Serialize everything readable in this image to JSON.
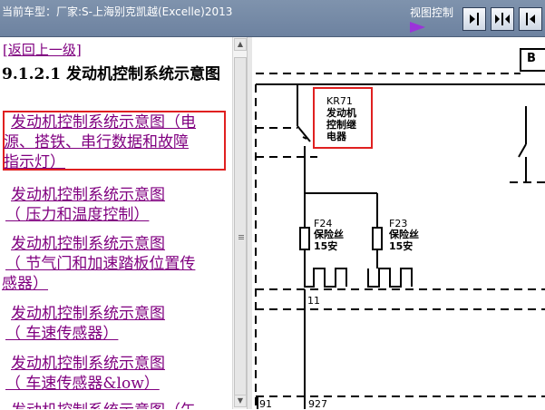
{
  "header": {
    "title": "当前车型：厂家:S-上海别克凯越(Excelle)2013",
    "view_control_label": "视图控制"
  },
  "nav": {
    "back_label": "[返回上一级]",
    "section_heading": "9.1.2.1 发动机控制系统示意图",
    "links": [
      {
        "lines": [
          "发动机控制系统示意图（电",
          "源、搭铁、串行数据和故障",
          "指示灯）"
        ]
      },
      {
        "lines": [
          "发动机控制系统示意图",
          "（ 压力和温度控制）"
        ]
      },
      {
        "lines": [
          "发动机控制系统示意图",
          "（ 节气门和加速踏板位置传",
          "感器）"
        ]
      },
      {
        "lines": [
          "发动机控制系统示意图",
          "（ 车速传感器）"
        ]
      },
      {
        "lines": [
          "发动机控制系统示意图",
          "（ 车速传感器&low）"
        ]
      },
      {
        "lines": [
          "发动机控制系统示意图（午"
        ]
      }
    ]
  },
  "diagram": {
    "relay_code": "KR71",
    "relay_name_lines": [
      "发动机",
      "控制继",
      "电器"
    ],
    "fuse_f24_code": "F24",
    "fuse_f24_lines": [
      "保险丝",
      "15安"
    ],
    "fuse_f23_code": "F23",
    "fuse_f23_lines": [
      "保险丝",
      "15安"
    ],
    "wire_11": "11",
    "wire_91": "91",
    "wire_927": "927",
    "connector_label": "B"
  },
  "colors": {
    "toolbar_bg": "#7389a6",
    "link_color": "#800080",
    "highlight_red": "#e02020",
    "arrow_purple": "#9b34d9"
  }
}
